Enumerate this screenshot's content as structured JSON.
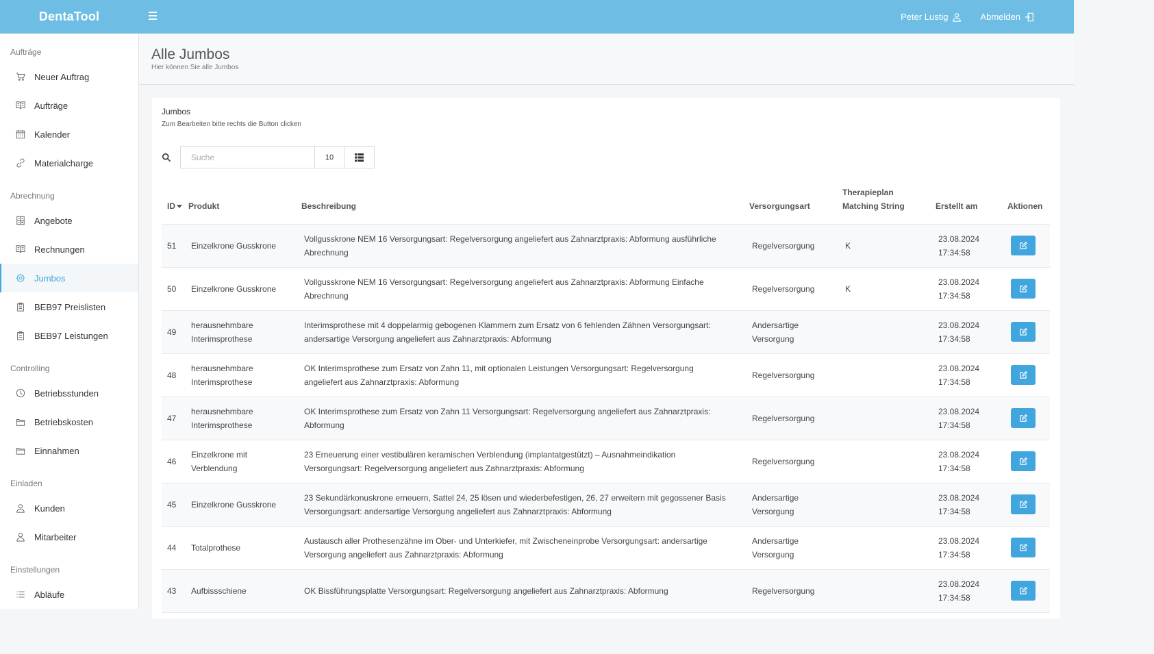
{
  "app": {
    "brand": "DentaTool"
  },
  "header": {
    "user_name": "Peter Lustig",
    "logout_label": "Abmelden"
  },
  "sidebar": {
    "sections": [
      {
        "label": "Aufträge",
        "items": [
          {
            "label": "Neuer Auftrag",
            "icon": "cart-icon"
          },
          {
            "label": "Aufträge",
            "icon": "book-icon"
          },
          {
            "label": "Kalender",
            "icon": "calendar-icon"
          },
          {
            "label": "Materialcharge",
            "icon": "link-icon"
          }
        ]
      },
      {
        "label": "Abrechnung",
        "items": [
          {
            "label": "Angebote",
            "icon": "calculator-icon"
          },
          {
            "label": "Rechnungen",
            "icon": "book-icon"
          },
          {
            "label": "Jumbos",
            "icon": "gear-icon",
            "active": true
          },
          {
            "label": "BEB97 Preislisten",
            "icon": "clipboard-icon"
          },
          {
            "label": "BEB97 Leistungen",
            "icon": "clipboard-icon"
          }
        ]
      },
      {
        "label": "Controlling",
        "items": [
          {
            "label": "Betriebsstunden",
            "icon": "clock-icon"
          },
          {
            "label": "Betriebskosten",
            "icon": "folder-icon"
          },
          {
            "label": "Einnahmen",
            "icon": "folder-icon"
          }
        ]
      },
      {
        "label": "Einladen",
        "items": [
          {
            "label": "Kunden",
            "icon": "user-icon"
          },
          {
            "label": "Mitarbeiter",
            "icon": "user-icon"
          }
        ]
      },
      {
        "label": "Einstellungen",
        "items": [
          {
            "label": "Abläufe",
            "icon": "list-icon"
          }
        ]
      }
    ]
  },
  "page": {
    "title": "Alle Jumbos",
    "subtitle": "Hier können Sie alle Jumbos"
  },
  "card": {
    "title": "Jumbos",
    "subtitle": "Zum Bearbeiten bitte rechts die Button clicken"
  },
  "toolbar": {
    "search_placeholder": "Suche",
    "search_value": "",
    "page_size": "10"
  },
  "table": {
    "columns": {
      "id": "ID",
      "produkt": "Produkt",
      "beschreibung": "Beschreibung",
      "versorgungsart": "Versorgungsart",
      "therapieplan_line1": "Therapieplan",
      "therapieplan_line2": "Matching String",
      "erstellt": "Erstellt am",
      "aktionen": "Aktionen"
    },
    "rows": [
      {
        "id": "51",
        "produkt": "Einzelkrone Gusskrone",
        "beschreibung": "Vollgusskrone NEM 16 Versorgungsart: Regelversorgung angeliefert aus Zahnarztpraxis: Abformung ausführliche Abrechnung",
        "versorgungsart": "Regelversorgung",
        "therapieplan": "K",
        "date": "23.08.2024",
        "time": "17:34:58"
      },
      {
        "id": "50",
        "produkt": "Einzelkrone Gusskrone",
        "beschreibung": "Vollgusskrone NEM 16 Versorgungsart: Regelversorgung angeliefert aus Zahnarztpraxis: Abformung Einfache Abrechnung",
        "versorgungsart": "Regelversorgung",
        "therapieplan": "K",
        "date": "23.08.2024",
        "time": "17:34:58"
      },
      {
        "id": "49",
        "produkt": "herausnehmbare Interimsprothese",
        "beschreibung": "Interimsprothese mit 4 doppelarmig gebogenen Klammern zum Ersatz von 6 fehlenden Zähnen Versorgungsart: andersartige Versorgung angeliefert aus Zahnarztpraxis: Abformung",
        "versorgungsart": "Andersartige Versorgung",
        "therapieplan": "",
        "date": "23.08.2024",
        "time": "17:34:58"
      },
      {
        "id": "48",
        "produkt": "herausnehmbare Interimsprothese",
        "beschreibung": "OK Interimsprothese zum Ersatz von Zahn 11, mit optionalen Leistungen Versorgungsart: Regelversorgung angeliefert aus Zahnarztpraxis: Abformung",
        "versorgungsart": "Regelversorgung",
        "therapieplan": "",
        "date": "23.08.2024",
        "time": "17:34:58"
      },
      {
        "id": "47",
        "produkt": "herausnehmbare Interimsprothese",
        "beschreibung": "OK Interimsprothese zum Ersatz von Zahn 11 Versorgungsart: Regelversorgung angeliefert aus Zahnarztpraxis: Abformung",
        "versorgungsart": "Regelversorgung",
        "therapieplan": "",
        "date": "23.08.2024",
        "time": "17:34:58"
      },
      {
        "id": "46",
        "produkt": "Einzelkrone mit Verblendung",
        "beschreibung": "23 Erneuerung einer vestibulären keramischen Verblendung (implantatgestützt) – Ausnahmeindikation Versorgungsart: Regelversorgung angeliefert aus Zahnarztpraxis: Abformung",
        "versorgungsart": "Regelversorgung",
        "therapieplan": "",
        "date": "23.08.2024",
        "time": "17:34:58"
      },
      {
        "id": "45",
        "produkt": "Einzelkrone Gusskrone",
        "beschreibung": "23 Sekundärkonuskrone erneuern, Sattel 24, 25 lösen und wiederbefestigen, 26, 27 erweitern mit gegossener Basis Versorgungsart: andersartige Versorgung angeliefert aus Zahnarztpraxis: Abformung",
        "versorgungsart": "Andersartige Versorgung",
        "therapieplan": "",
        "date": "23.08.2024",
        "time": "17:34:58"
      },
      {
        "id": "44",
        "produkt": "Totalprothese",
        "beschreibung": "Austausch aller Prothesenzähne im Ober- und Unterkiefer, mit Zwischeneinprobe Versorgungsart: andersartige Versorgung angeliefert aus Zahnarztpraxis: Abformung",
        "versorgungsart": "Andersartige Versorgung",
        "therapieplan": "",
        "date": "23.08.2024",
        "time": "17:34:58"
      },
      {
        "id": "43",
        "produkt": "Aufbissschiene",
        "beschreibung": "OK Bissführungsplatte Versorgungsart: Regelversorgung angeliefert aus Zahnarztpraxis: Abformung",
        "versorgungsart": "Regelversorgung",
        "therapieplan": "",
        "date": "23.08.2024",
        "time": "17:34:58"
      }
    ]
  }
}
